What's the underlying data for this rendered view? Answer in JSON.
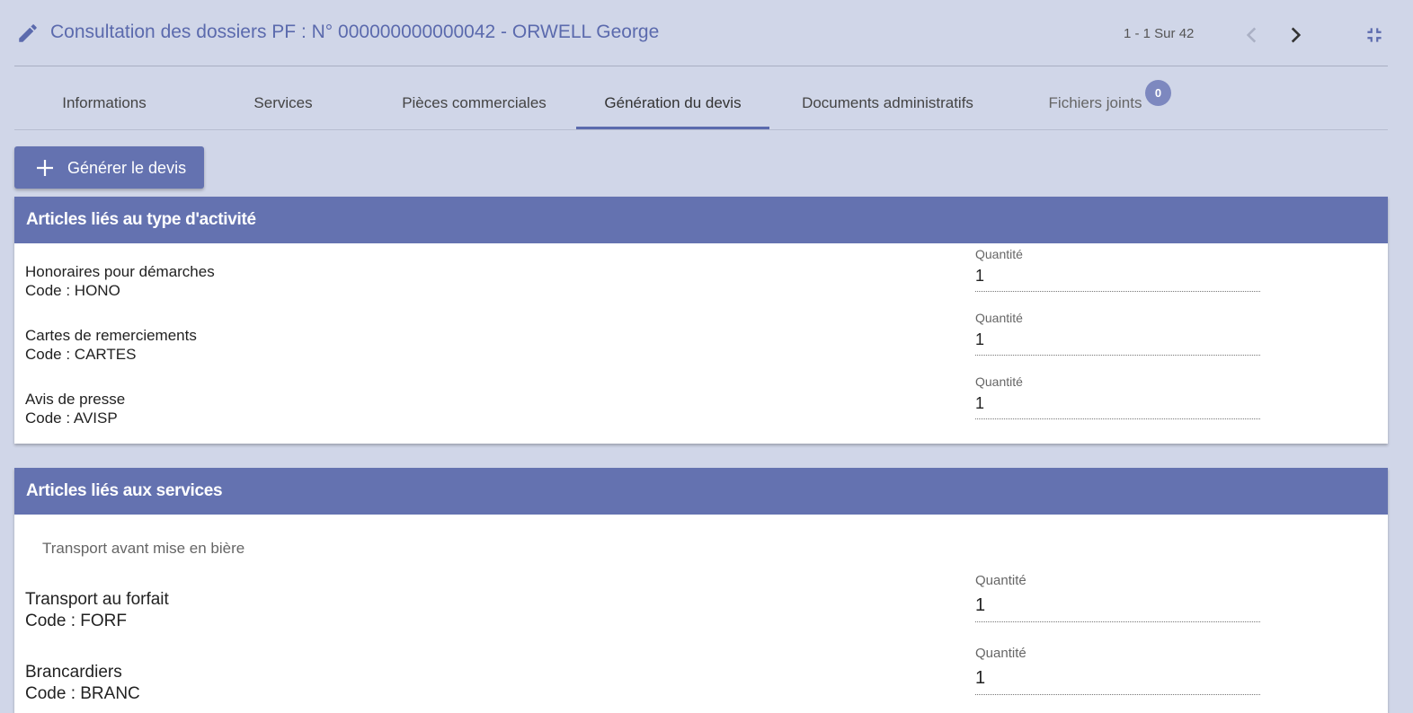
{
  "header": {
    "title": "Consultation des dossiers PF : N° 000000000000042 - ORWELL George",
    "pager": "1 - 1 Sur 42",
    "icons": {
      "edit": "pencil-icon",
      "prev": "chevron-left-icon",
      "next": "chevron-right-icon",
      "collapse": "fullscreen-exit-icon"
    }
  },
  "tabs": [
    {
      "label": "Informations"
    },
    {
      "label": "Services"
    },
    {
      "label": "Pièces commerciales"
    },
    {
      "label": "Génération du devis",
      "active": true
    },
    {
      "label": "Documents administratifs"
    },
    {
      "label": "Fichiers joints",
      "badge": "0"
    }
  ],
  "generate_button": {
    "label": "Générer le devis",
    "icon": "plus-icon"
  },
  "activity_panel": {
    "title": "Articles liés au type d'activité",
    "items": [
      {
        "name": "Honoraires pour démarches",
        "code": "Code : HONO",
        "qty_label": "Quantité",
        "qty": "1"
      },
      {
        "name": "Cartes de remerciements",
        "code": "Code : CARTES",
        "qty_label": "Quantité",
        "qty": "1"
      },
      {
        "name": "Avis de presse",
        "code": "Code : AVISP",
        "qty_label": "Quantité",
        "qty": "1"
      }
    ]
  },
  "services_panel": {
    "title": "Articles liés aux services",
    "group": "Transport avant mise en bière",
    "items": [
      {
        "name": "Transport au forfait",
        "code": "Code : FORF",
        "qty_label": "Quantité",
        "qty": "1"
      },
      {
        "name": "Brancardiers",
        "code": "Code : BRANC",
        "qty_label": "Quantité",
        "qty": "1"
      }
    ]
  },
  "colors": {
    "accent": "#6472b0",
    "title": "#5b6aad",
    "background": "#d0d6e8",
    "badge": "#7d88bf"
  }
}
